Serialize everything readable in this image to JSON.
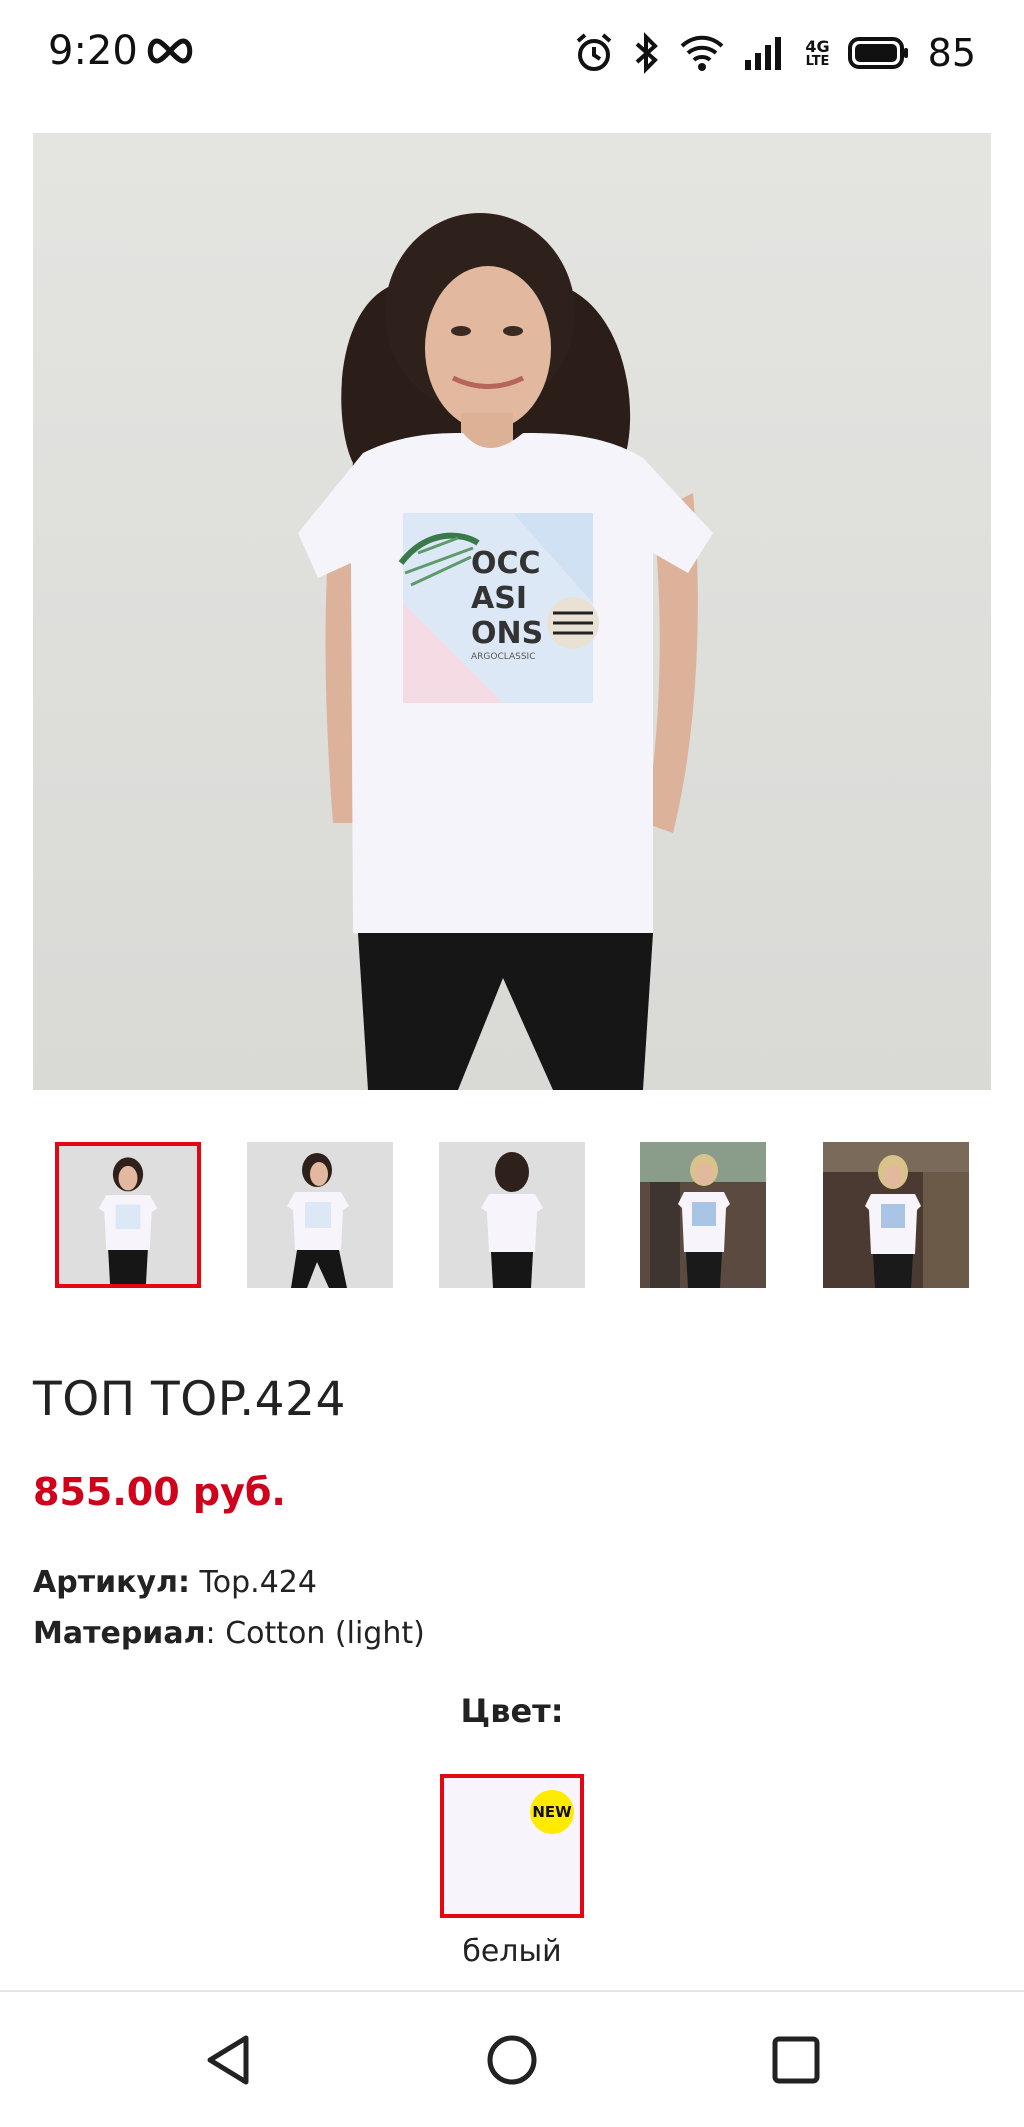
{
  "status_bar": {
    "time": "9:20",
    "battery": "85",
    "network_top": "4G",
    "network_bottom": "LTE",
    "icons": [
      "infinity-icon",
      "alarm-icon",
      "bluetooth-icon",
      "wifi-icon",
      "signal-icon",
      "battery-icon"
    ]
  },
  "product": {
    "title": "ТОП TOP.424",
    "price": "855.00 руб.",
    "article_label": "Артикул:",
    "article_value": "Top.424",
    "material_label": "Материал",
    "material_value": ": Cotton (light)"
  },
  "hero": {
    "print_line1": "OCC",
    "print_line2": "ASI",
    "print_line3": "ONS",
    "print_sub": "ARGOCLASSIC"
  },
  "thumbnails": {
    "count": 5,
    "selected_index": 0
  },
  "color": {
    "heading": "Цвет:",
    "badge": "NEW",
    "name": "белый"
  },
  "nav": {
    "icons": [
      "back-icon",
      "home-icon",
      "recents-icon"
    ]
  },
  "colors": {
    "accent": "#e30613",
    "price": "#d0021b",
    "badge": "#ffeb00"
  }
}
